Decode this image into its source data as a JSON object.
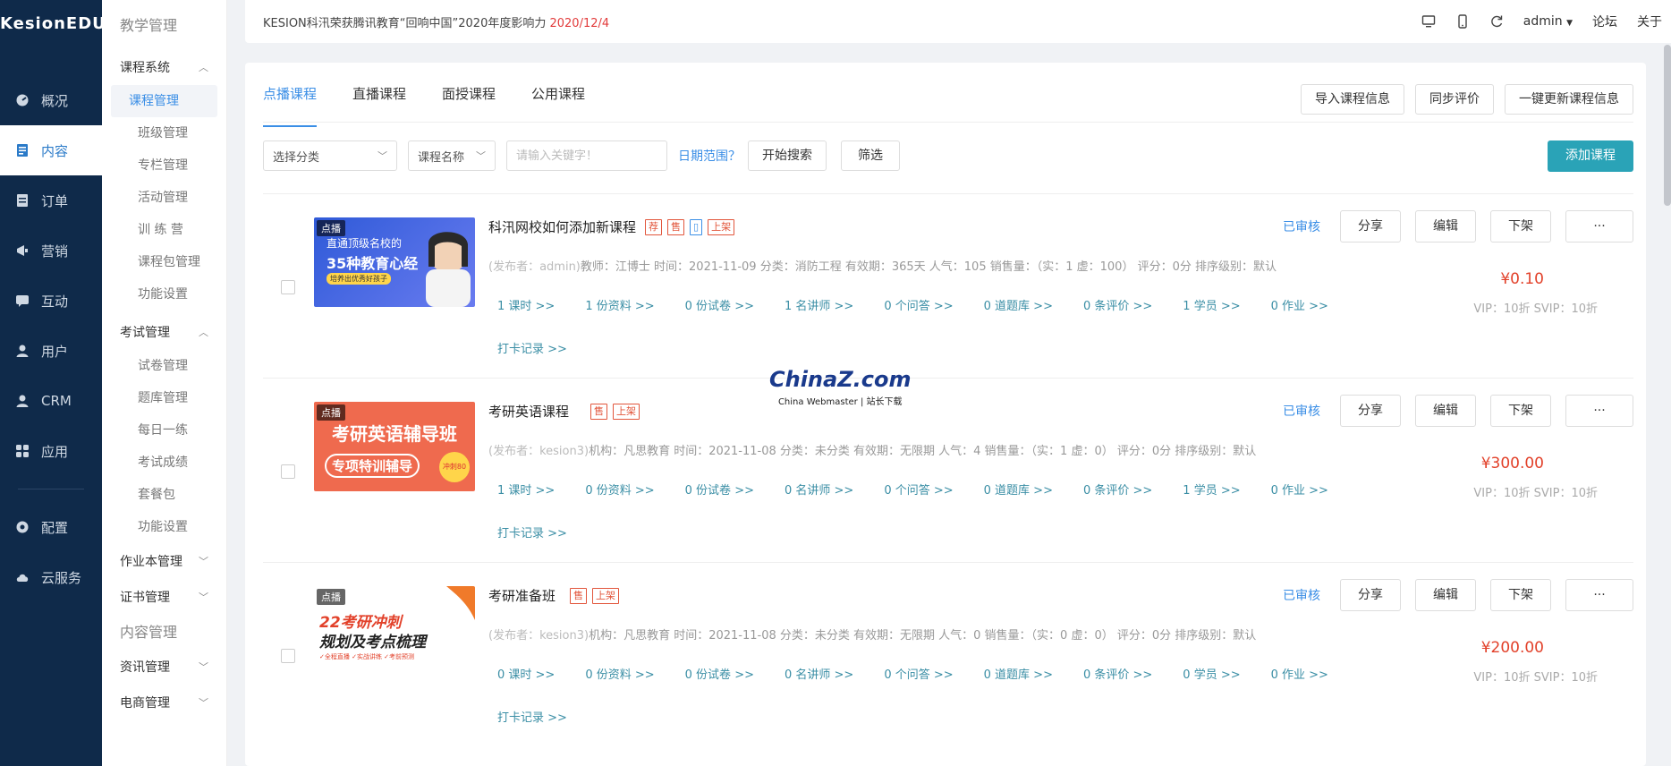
{
  "app": {
    "logo": "KesionEDU"
  },
  "leftnav": {
    "items": [
      {
        "label": "概况",
        "icon": "dashboard-icon"
      },
      {
        "label": "内容",
        "icon": "content-icon",
        "active": true
      },
      {
        "label": "订单",
        "icon": "order-icon"
      },
      {
        "label": "营销",
        "icon": "marketing-icon"
      },
      {
        "label": "互动",
        "icon": "interact-icon"
      },
      {
        "label": "用户",
        "icon": "user-icon"
      },
      {
        "label": "CRM",
        "icon": "crm-icon"
      },
      {
        "label": "应用",
        "icon": "apps-icon"
      }
    ],
    "bottom": [
      {
        "label": "配置",
        "icon": "config-icon"
      },
      {
        "label": "云服务",
        "icon": "cloud-icon"
      }
    ]
  },
  "subnav": {
    "title": "教学管理",
    "group1": {
      "label": "课程系统",
      "items": [
        "课程管理",
        "班级管理",
        "专栏管理",
        "活动管理",
        "训 练 营",
        "课程包管理",
        "功能设置"
      ]
    },
    "group2": {
      "label": "考试管理",
      "items": [
        "试卷管理",
        "题库管理",
        "每日一练",
        "考试成绩",
        "套餐包",
        "功能设置"
      ]
    },
    "group3": {
      "label": "作业本管理"
    },
    "group4": {
      "label": "证书管理"
    },
    "title2": "内容管理",
    "group5": {
      "label": "资讯管理"
    },
    "group6": {
      "label": "电商管理"
    }
  },
  "topbar": {
    "notice": "KESION科汛荣获腾讯教育“回响中国”2020年度影响力",
    "notice_date": "2020/12/4",
    "user": "admin",
    "forum": "论坛",
    "about": "关于"
  },
  "tabs": [
    "点播课程",
    "直播课程",
    "面授课程",
    "公用课程"
  ],
  "top_actions": [
    "导入课程信息",
    "同步评价",
    "一键更新课程信息"
  ],
  "filters": {
    "category": "选择分类",
    "field": "课程名称",
    "keyword_placeholder": "请输入关键字！",
    "date_range": "日期范围？",
    "search_btn": "开始搜索",
    "filter_btn": "筛选",
    "add_btn": "添加课程"
  },
  "row_actions": {
    "share": "分享",
    "edit": "编辑",
    "offline": "下架",
    "more": "···"
  },
  "courses": [
    {
      "badge": "点播",
      "title": "科汛网校如何添加新课程",
      "tags": [
        "荐",
        "售",
        "▯",
        "上架"
      ],
      "meta_pub": "(发布者：admin)",
      "meta": "教师：江博士     时间：2021-11-09     分类：消防工程     有效期：365天     人气：105     销售量：（实：1 虚：100）     评分：0分     排序级别：默认",
      "links": [
        "1 课时 >>",
        "1 份资料 >>",
        "0 份试卷 >>",
        "1 名讲师 >>",
        "0 个问答 >>",
        "0 道题库 >>",
        "0 条评价 >>",
        "1 学员 >>",
        "0 作业 >>"
      ],
      "punch": "打卡记录 >>",
      "status": "已审核",
      "price": "¥0.10",
      "vip": "VIP：10折 SVIP：10折",
      "thumb_text1": "直通顶级名校的",
      "thumb_text2": "35种教育心经",
      "thumb_text3": "培养出优秀好孩子"
    },
    {
      "badge": "点播",
      "title": "考研英语课程",
      "tags": [
        "售",
        "上架"
      ],
      "meta_pub": "(发布者：kesion3)",
      "meta": "机构：凡思教育     时间：2021-11-08     分类：未分类     有效期：无限期     人气：4     销售量：（实：1 虚：0）     评分：0分     排序级别：默认",
      "links": [
        "1 课时 >>",
        "0 份资料 >>",
        "0 份试卷 >>",
        "0 名讲师 >>",
        "0 个问答 >>",
        "0 道题库 >>",
        "0 条评价 >>",
        "1 学员 >>",
        "0 作业 >>"
      ],
      "punch": "打卡记录 >>",
      "status": "已审核",
      "price": "¥300.00",
      "vip": "VIP：10折 SVIP：10折",
      "thumb_text1": "考研英语辅导班",
      "thumb_text2": "专项特训辅导",
      "thumb_text3": "冲刺80分"
    },
    {
      "badge": "点播",
      "title": "考研准备班",
      "tags": [
        "售",
        "上架"
      ],
      "meta_pub": "(发布者：kesion3)",
      "meta": "机构：凡思教育     时间：2021-11-08     分类：未分类     有效期：无限期     人气：0     销售量：（实：0 虚：0）     评分：0分     排序级别：默认",
      "links": [
        "0 课时 >>",
        "0 份资料 >>",
        "0 份试卷 >>",
        "0 名讲师 >>",
        "0 个问答 >>",
        "0 道题库 >>",
        "0 条评价 >>",
        "0 学员 >>",
        "0 作业 >>"
      ],
      "punch": "打卡记录 >>",
      "status": "已审核",
      "price": "¥200.00",
      "vip": "VIP：10折 SVIP：10折",
      "thumb_text1": "22考研冲刺",
      "thumb_text2": "规划及考点梳理",
      "thumb_text3": "✓全程直播 ✓实战讲练 ✓考前预测"
    }
  ],
  "watermark": {
    "big": "ChinaZ.com",
    "small": "China Webmaster | 站长下载"
  }
}
